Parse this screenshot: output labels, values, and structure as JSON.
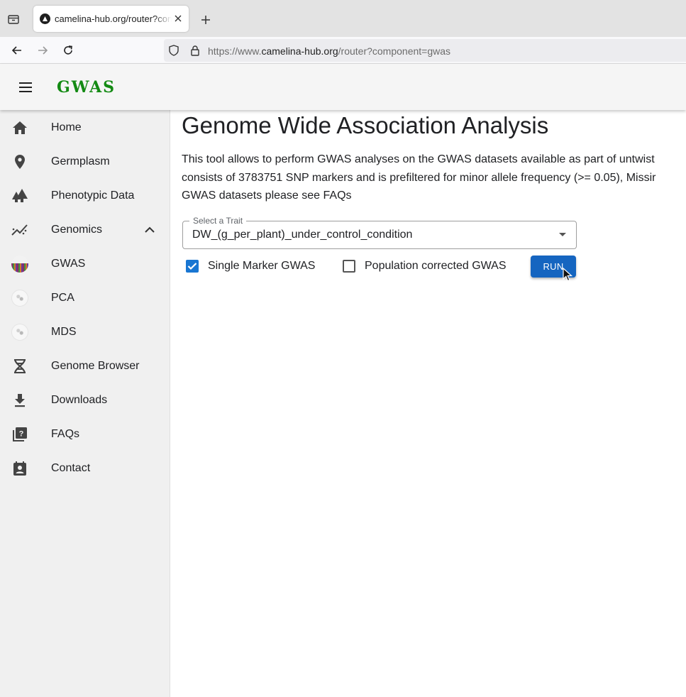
{
  "browser": {
    "tab_title": "camelina-hub.org/router?component=gwas",
    "url_prefix": "https://www.",
    "url_host": "camelina-hub.org",
    "url_path": "/router?component=gwas"
  },
  "app": {
    "title": "GWAS",
    "title_color": "#138a13",
    "accent_color": "#1976d2"
  },
  "sidebar": {
    "items": [
      {
        "label": "Home",
        "icon": "home-icon"
      },
      {
        "label": "Germplasm",
        "icon": "location-pin-icon"
      },
      {
        "label": "Phenotypic Data",
        "icon": "trees-icon"
      },
      {
        "label": "Genomics",
        "icon": "chart-line-icon",
        "expanded": true
      },
      {
        "label": "GWAS",
        "icon": "gwas-thumbnail-icon"
      },
      {
        "label": "PCA",
        "icon": "pca-thumbnail-icon"
      },
      {
        "label": "MDS",
        "icon": "mds-thumbnail-icon"
      },
      {
        "label": "Genome Browser",
        "icon": "dna-icon"
      },
      {
        "label": "Downloads",
        "icon": "download-icon"
      },
      {
        "label": "FAQs",
        "icon": "quiz-icon"
      },
      {
        "label": "Contact",
        "icon": "contact-icon"
      }
    ]
  },
  "main": {
    "title": "Genome Wide Association Analysis",
    "description_lines": [
      "This tool allows to perform GWAS analyses on the GWAS datasets available as part of untwist",
      "consists of 3783751 SNP markers and is prefiltered for minor allele frequency (>= 0.05), Missir",
      "GWAS datasets please see FAQs"
    ],
    "trait_select": {
      "label": "Select a Trait",
      "value": "DW_(g_per_plant)_under_control_condition"
    },
    "options": {
      "single_marker": {
        "label": "Single Marker GWAS",
        "checked": true
      },
      "population_corrected": {
        "label": "Population corrected GWAS",
        "checked": false
      }
    },
    "run_label": "RUN"
  }
}
